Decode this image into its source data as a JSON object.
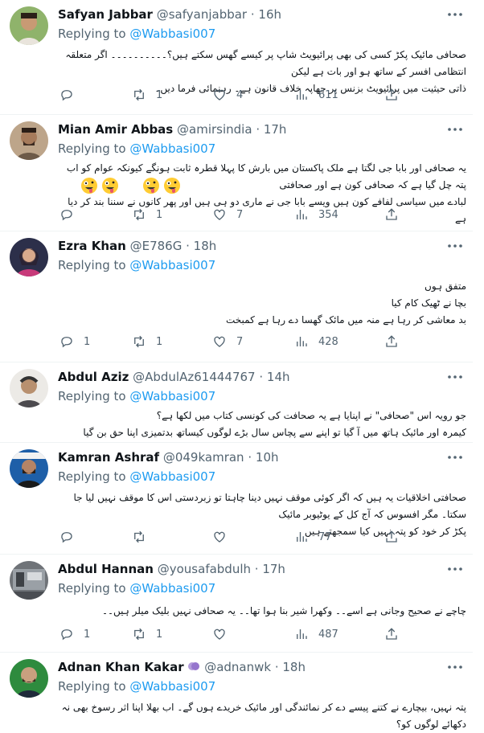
{
  "colors": {
    "link": "#1d9bf0",
    "muted": "#536471",
    "text": "#0f1419"
  },
  "replying_label": "Replying to",
  "tweets": [
    {
      "name": "Safyan Jabbar",
      "handle": "@safyanjabbar",
      "time": "· 16h",
      "mention": "@Wabbasi007",
      "lines": [
        "صحافی مائیک پکڑ کسی کی بھی پرائیویٹ شاپ پر کیسے گھس سکتے ہیں؟۔۔۔۔۔۔۔۔۔۔ اگر متعلقہ انتظامی افسر کے ساتھ ہو اور بات ہے لیکن",
        "ذاتی حیثیت میں پرائیویٹ بزنس پر چھاپہ خلاف قانون ہے۔ رہنمائی فرما دیں۔"
      ],
      "reply": "",
      "retweet": "1",
      "like": "4",
      "views": "611"
    },
    {
      "name": "Mian Amir Abbas",
      "handle": "@amirsindia",
      "time": "· 17h",
      "mention": "@Wabbasi007",
      "lines": [
        "یہ صحافی اور بابا جی لگتا ہے ملک پاکستان میں بارش کا پہلا قطرہ ثابت ہونگے کیونکہ عوام کو اب پتہ چل گیا ہے کہ صحافی کون ہے اور صحافتی",
        "لبادے میں سیاسی لفافے کون ہیں ویسے بابا جی نے ماری دو ہی ہیں اور پھر کانوں نے سننا بند کر دیا ہے"
      ],
      "reply": "",
      "retweet": "1",
      "like": "7",
      "views": "354"
    },
    {
      "name": "Ezra Khan",
      "handle": "@E786G",
      "time": "· 18h",
      "mention": "@Wabbasi007",
      "lines": [
        "متفق ہوں",
        "بچا نے ٹھیک کام کیا",
        "بد معاشی کر رہا ہے منہ میں مائک گھسا دے رہا ہے کمبخت"
      ],
      "reply": "1",
      "retweet": "1",
      "like": "7",
      "views": "428"
    },
    {
      "name": "Abdul Aziz",
      "handle": "@AbdulAz61444767",
      "time": "· 14h",
      "mention": "@Wabbasi007",
      "lines": [
        "جو رویہ اس \"صحافی\" نے اپنایا ہے یہ صحافت کی کونسی کتاب میں لکھا ہے؟",
        "کیمرہ اور مائیک ہاتھ میں آ گیا تو اپنے سے پچاس سال بڑے لوگوں کیساتھ بدتمیزی اپنا حق بن گیا"
      ],
      "reply": "",
      "retweet": "",
      "like": "",
      "views": ""
    },
    {
      "name": "Kamran Ashraf",
      "handle": "@049kamran",
      "time": "· 10h",
      "mention": "@Wabbasi007",
      "lines": [
        "صحافتی اخلاقیات یہ ہیں کہ اگر کوئی موقف نہیں دینا چاہتا تو زبردستی اس کا موقف نہیں لیا جا سکتا۔ مگر افسوس کہ آج کل کے یوٹیوبر مائیک",
        "پکڑ کر خود کو پتہ نہیں کیا سمجھتے ہیں"
      ],
      "reply": "",
      "retweet": "",
      "like": "",
      "views": "77"
    },
    {
      "name": "Abdul Hannan",
      "handle": "@yousafabdulh",
      "time": "· 17h",
      "mention": "@Wabbasi007",
      "lines": [
        "چاچے نے صحیح وجانی ہے اسے۔۔ وکھرا شیر بنا ہوا تھا۔۔ یہ صحافی نہیں بلیک میلر ہیں۔۔"
      ],
      "reply": "1",
      "retweet": "1",
      "like": "",
      "views": "487"
    },
    {
      "name": "Adnan Khan Kakar",
      "handle": "@adnanwk",
      "time": "· 18h",
      "mention": "@Wabbasi007",
      "lines": [
        "پتہ نہیں، بیچارے نے کتنے پیسے دے کر نمائندگی اور مائیک خریدے ہوں گے۔ اب بھلا اپنا اثر رسوخ بھی نہ دکھائے لوگوں کو؟"
      ],
      "reply": "",
      "retweet": "",
      "like": "",
      "views": ""
    }
  ]
}
